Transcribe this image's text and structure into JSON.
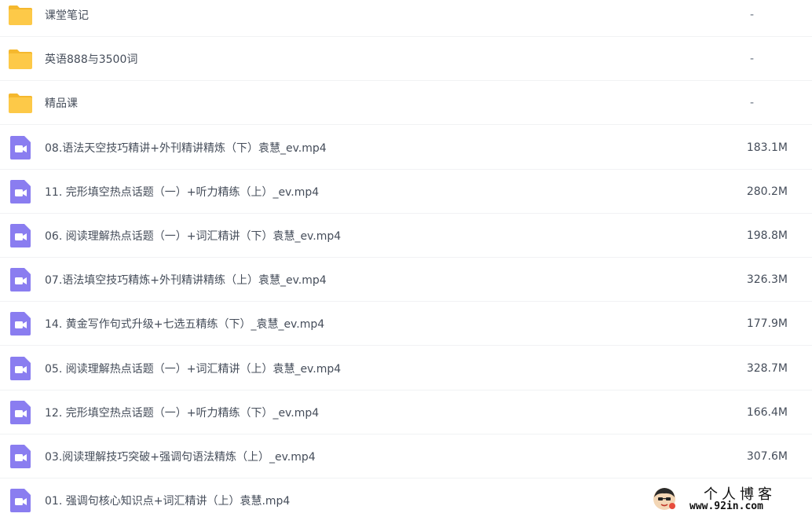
{
  "files": [
    {
      "type": "folder",
      "icon": "folder-icon",
      "name": "课堂笔记",
      "size": "-"
    },
    {
      "type": "folder",
      "icon": "folder-icon",
      "name": "英语888与3500词",
      "size": "-"
    },
    {
      "type": "folder",
      "icon": "folder-icon",
      "name": "精品课",
      "size": "-"
    },
    {
      "type": "video",
      "icon": "video-file-icon",
      "name": "08.语法天空技巧精讲+外刊精讲精炼（下）袁慧_ev.mp4",
      "size": "183.1M"
    },
    {
      "type": "video",
      "icon": "video-file-icon",
      "name": "11. 完形填空热点话题（一）+听力精练（上）_ev.mp4",
      "size": "280.2M"
    },
    {
      "type": "video",
      "icon": "video-file-icon",
      "name": "06. 阅读理解热点话题（一）+词汇精讲（下）袁慧_ev.mp4",
      "size": "198.8M"
    },
    {
      "type": "video",
      "icon": "video-file-icon",
      "name": "07.语法填空技巧精炼+外刊精讲精练（上）袁慧_ev.mp4",
      "size": "326.3M"
    },
    {
      "type": "video",
      "icon": "video-file-icon",
      "name": "14. 黄金写作句式升级+七选五精练（下）_袁慧_ev.mp4",
      "size": "177.9M"
    },
    {
      "type": "video",
      "icon": "video-file-icon",
      "name": "05. 阅读理解热点话题（一）+词汇精讲（上）袁慧_ev.mp4",
      "size": "328.7M"
    },
    {
      "type": "video",
      "icon": "video-file-icon",
      "name": "12. 完形填空热点话题（一）+听力精练（下）_ev.mp4",
      "size": "166.4M"
    },
    {
      "type": "video",
      "icon": "video-file-icon",
      "name": "03.阅读理解技巧突破+强调句语法精炼（上）_ev.mp4",
      "size": "307.6M"
    },
    {
      "type": "video",
      "icon": "video-file-icon",
      "name": "01. 强调句核心知识点+词汇精讲（上）袁慧.mp4",
      "size": ""
    }
  ],
  "colors": {
    "folder": "#fdc948",
    "folder_tab": "#f5b82e",
    "video": "#8a7df0",
    "text": "#454d5a",
    "divider": "#f1f2f4"
  },
  "watermark": {
    "title": "个人博客",
    "url": "www.92in.com"
  }
}
